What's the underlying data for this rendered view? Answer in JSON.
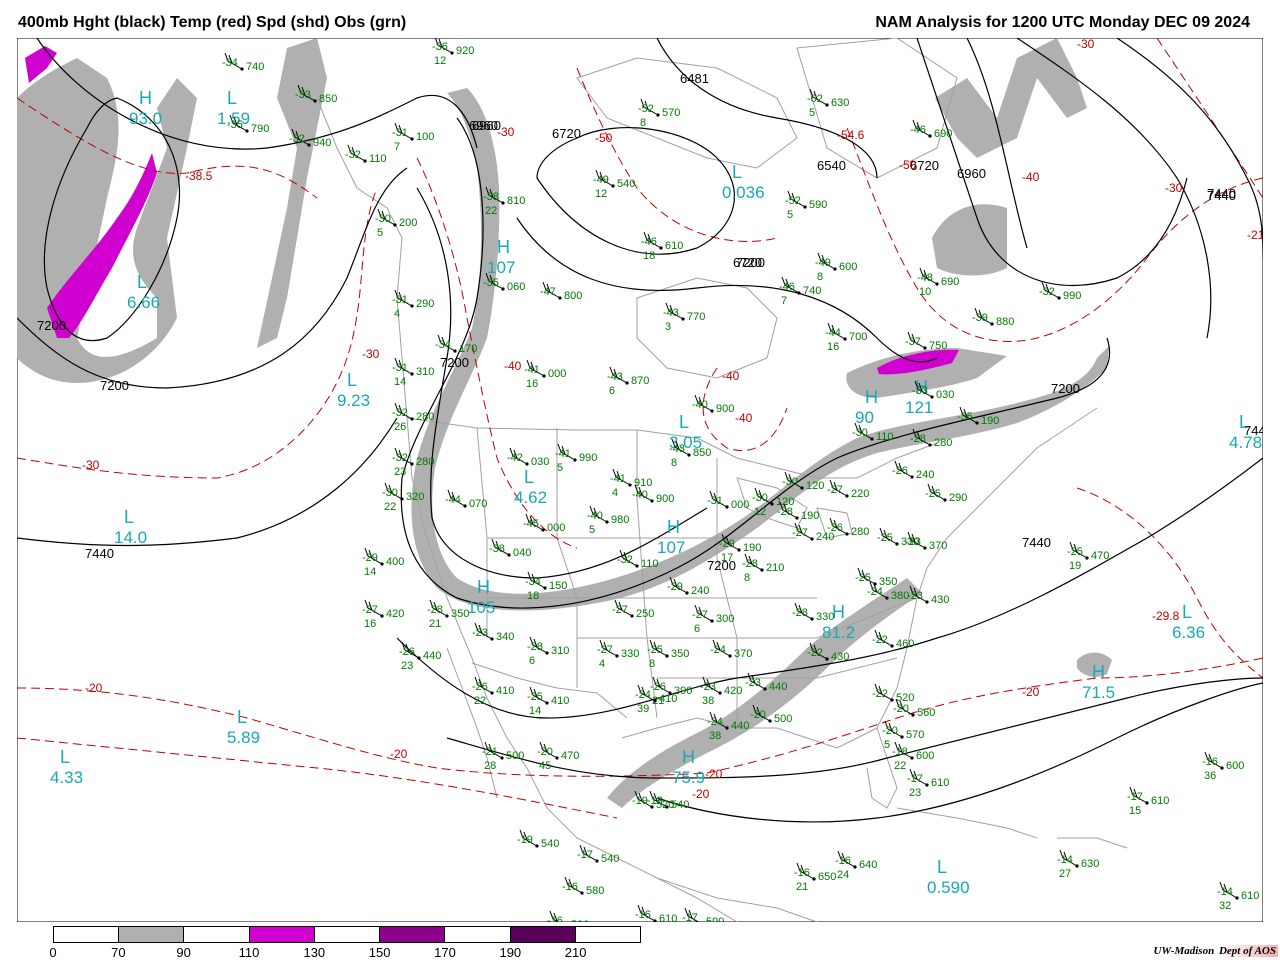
{
  "header": {
    "title_left": "400mb Hght (black) Temp (red) Spd (shd) Obs (grn)",
    "title_right": "NAM Analysis for 1200 UTC Monday  DEC 09 2024"
  },
  "colors": {
    "height_contour": "#000000",
    "temp_contour": "#c00000",
    "obs": "#007a00",
    "centers": "#18a8b8",
    "coast": "#a0a0a0",
    "speed_70_90": "#b0b0b0",
    "speed_110_130": "#d000d0",
    "speed_150_170": "#8c008c",
    "speed_190_210": "#5a005a"
  },
  "colorbar": {
    "labels": [
      "0",
      "70",
      "90",
      "110",
      "130",
      "150",
      "170",
      "190",
      "210"
    ],
    "fills": [
      "#ffffff",
      "#b0b0b0",
      "#ffffff",
      "#d000d0",
      "#ffffff",
      "#8c008c",
      "#ffffff",
      "#5a005a",
      "#ffffff"
    ]
  },
  "credit": {
    "org": "UW-Madison",
    "dept": "Dept of AOS"
  },
  "map": {
    "height_labels": [
      "6960",
      "6720",
      "6540",
      "6720",
      "6960",
      "7440",
      "7200",
      "7200",
      "7200",
      "7200",
      "7440",
      "7200",
      "7440",
      "7200",
      "6481",
      "6720",
      "6960",
      "7440",
      "7440"
    ],
    "temp_labels": [
      "-38.5",
      "-30",
      "-40",
      "-50",
      "-30",
      "-40",
      "-40",
      "-30",
      "-20",
      "-20",
      "-20",
      "-20",
      "-30",
      "-54.6",
      "-50",
      "-40",
      "-30",
      "-21",
      "-20",
      "-29.8"
    ],
    "centers": [
      {
        "letter": "H",
        "value": "93.0"
      },
      {
        "letter": "L",
        "value": "1.59"
      },
      {
        "letter": "L",
        "value": "6.66"
      },
      {
        "letter": "H",
        "value": "107"
      },
      {
        "letter": "L",
        "value": "9.23"
      },
      {
        "letter": "L",
        "value": "14.0"
      },
      {
        "letter": "L",
        "value": "4.62"
      },
      {
        "letter": "L",
        "value": "3.05"
      },
      {
        "letter": "H",
        "value": "107"
      },
      {
        "letter": "H",
        "value": "105"
      },
      {
        "letter": "L",
        "value": "5.89"
      },
      {
        "letter": "L",
        "value": "4.33"
      },
      {
        "letter": "L",
        "value": "0.036"
      },
      {
        "letter": "H",
        "value": "121"
      },
      {
        "letter": "H",
        "value": "90"
      },
      {
        "letter": "L",
        "value": "4.78"
      },
      {
        "letter": "H",
        "value": "81.2"
      },
      {
        "letter": "H",
        "value": "75.9"
      },
      {
        "letter": "L",
        "value": "0.590"
      },
      {
        "letter": "L",
        "value": "6.36"
      },
      {
        "letter": "H",
        "value": "71.5"
      }
    ],
    "observations": [
      {
        "t": "-34",
        "h": "740",
        "d": ""
      },
      {
        "t": "-35",
        "h": "790",
        "d": ""
      },
      {
        "t": "-33",
        "h": "850",
        "d": ""
      },
      {
        "t": "-32",
        "h": "940",
        "d": ""
      },
      {
        "t": "-36",
        "h": "920",
        "d": "12"
      },
      {
        "t": "-31",
        "h": "100",
        "d": "7"
      },
      {
        "t": "-32",
        "h": "110",
        "d": ""
      },
      {
        "t": "-30",
        "h": "200",
        "d": "5"
      },
      {
        "t": "-31",
        "h": "290",
        "d": "4"
      },
      {
        "t": "-31",
        "h": "310",
        "d": "14"
      },
      {
        "t": "-32",
        "h": "280",
        "d": "26"
      },
      {
        "t": "-32",
        "h": "280",
        "d": "23"
      },
      {
        "t": "-30",
        "h": "320",
        "d": "22"
      },
      {
        "t": "-29",
        "h": "400",
        "d": "14"
      },
      {
        "t": "-27",
        "h": "420",
        "d": "16"
      },
      {
        "t": "-26",
        "h": "440",
        "d": "23"
      },
      {
        "t": "-28",
        "h": "350",
        "d": "21"
      },
      {
        "t": "-23",
        "h": "340",
        "d": ""
      },
      {
        "t": "-26",
        "h": "410",
        "d": "22"
      },
      {
        "t": "-25",
        "h": "410",
        "d": "14"
      },
      {
        "t": "-21",
        "h": "500",
        "d": "28"
      },
      {
        "t": "-20",
        "h": "470",
        "d": "45"
      },
      {
        "t": "-34",
        "h": "170",
        "d": ""
      },
      {
        "t": "-44",
        "h": "070",
        "d": ""
      },
      {
        "t": "-35",
        "h": "060",
        "d": ""
      },
      {
        "t": "-38",
        "h": "810",
        "d": "22"
      },
      {
        "t": "-42",
        "h": "030",
        "d": ""
      },
      {
        "t": "-41",
        "h": "990",
        "d": "5"
      },
      {
        "t": "-41",
        "h": "910",
        "d": "4"
      },
      {
        "t": "-40",
        "h": "900",
        "d": ""
      },
      {
        "t": "-45",
        "h": "000",
        "d": ""
      },
      {
        "t": "-40",
        "h": "980",
        "d": "5"
      },
      {
        "t": "-38",
        "h": "040",
        "d": ""
      },
      {
        "t": "-34",
        "h": "150",
        "d": "18"
      },
      {
        "t": "-32",
        "h": "110",
        "d": ""
      },
      {
        "t": "-28",
        "h": "310",
        "d": "6"
      },
      {
        "t": "-27",
        "h": "330",
        "d": "4"
      },
      {
        "t": "-27",
        "h": "250",
        "d": ""
      },
      {
        "t": "-25",
        "h": "350",
        "d": "8"
      },
      {
        "t": "-29",
        "h": "240",
        "d": ""
      },
      {
        "t": "-27",
        "h": "300",
        "d": "6"
      },
      {
        "t": "-24",
        "h": "370",
        "d": ""
      },
      {
        "t": "-31",
        "h": "000",
        "d": ""
      },
      {
        "t": "-30",
        "h": "120",
        "d": "12"
      },
      {
        "t": "-29",
        "h": "190",
        "d": "17"
      },
      {
        "t": "-28",
        "h": "210",
        "d": "8"
      },
      {
        "t": "-30",
        "h": "120",
        "d": ""
      },
      {
        "t": "-28",
        "h": "190",
        "d": ""
      },
      {
        "t": "-27",
        "h": "240",
        "d": ""
      },
      {
        "t": "-28",
        "h": "330",
        "d": ""
      },
      {
        "t": "-26",
        "h": "390",
        "d": "21"
      },
      {
        "t": "-23",
        "h": "420",
        "d": "38"
      },
      {
        "t": "-24",
        "h": "410",
        "d": "39"
      },
      {
        "t": "-23",
        "h": "440",
        "d": ""
      },
      {
        "t": "-22",
        "h": "430",
        "d": ""
      },
      {
        "t": "-24",
        "h": "440",
        "d": "38"
      },
      {
        "t": "-20",
        "h": "500",
        "d": ""
      },
      {
        "t": "-19",
        "h": "520",
        "d": ""
      },
      {
        "t": "-18",
        "h": "540",
        "d": ""
      },
      {
        "t": "-19",
        "h": "540",
        "d": ""
      },
      {
        "t": "-17",
        "h": "540",
        "d": ""
      },
      {
        "t": "-16",
        "h": "580",
        "d": ""
      },
      {
        "t": "-16",
        "h": "590",
        "d": ""
      },
      {
        "t": "-16",
        "h": "610",
        "d": ""
      },
      {
        "t": "-17",
        "h": "590",
        "d": ""
      },
      {
        "t": "-16",
        "h": "650",
        "d": "21"
      },
      {
        "t": "-16",
        "h": "640",
        "d": "24"
      },
      {
        "t": "-47",
        "h": "800",
        "d": ""
      },
      {
        "t": "-43",
        "h": "770",
        "d": "3"
      },
      {
        "t": "-43",
        "h": "870",
        "d": "6"
      },
      {
        "t": "-40",
        "h": "900",
        "d": ""
      },
      {
        "t": "-43",
        "h": "850",
        "d": "8"
      },
      {
        "t": "-41",
        "h": "000",
        "d": "16"
      },
      {
        "t": "-52",
        "h": "570",
        "d": "8"
      },
      {
        "t": "-49",
        "h": "540",
        "d": "12"
      },
      {
        "t": "-46",
        "h": "610",
        "d": "18"
      },
      {
        "t": "-52",
        "h": "590",
        "d": "5"
      },
      {
        "t": "-49",
        "h": "600",
        "d": "8"
      },
      {
        "t": "-46",
        "h": "740",
        "d": "7"
      },
      {
        "t": "-62",
        "h": "630",
        "d": "5"
      },
      {
        "t": "-46",
        "h": "690",
        "d": ""
      },
      {
        "t": "-48",
        "h": "690",
        "d": "10"
      },
      {
        "t": "-44",
        "h": "700",
        "d": "16"
      },
      {
        "t": "-37",
        "h": "750",
        "d": ""
      },
      {
        "t": "-39",
        "h": "880",
        "d": ""
      },
      {
        "t": "-32",
        "h": "990",
        "d": ""
      },
      {
        "t": "-33",
        "h": "030",
        "d": ""
      },
      {
        "t": "-35",
        "h": "190",
        "d": ""
      },
      {
        "t": "-30",
        "h": "110",
        "d": ""
      },
      {
        "t": "-28",
        "h": "280",
        "d": ""
      },
      {
        "t": "-26",
        "h": "240",
        "d": ""
      },
      {
        "t": "-27",
        "h": "220",
        "d": ""
      },
      {
        "t": "-25",
        "h": "290",
        "d": ""
      },
      {
        "t": "-26",
        "h": "280",
        "d": ""
      },
      {
        "t": "-25",
        "h": "330",
        "d": ""
      },
      {
        "t": "-23",
        "h": "370",
        "d": ""
      },
      {
        "t": "-25",
        "h": "350",
        "d": ""
      },
      {
        "t": "-24",
        "h": "380",
        "d": ""
      },
      {
        "t": "-23",
        "h": "430",
        "d": ""
      },
      {
        "t": "-22",
        "h": "460",
        "d": ""
      },
      {
        "t": "-22",
        "h": "520",
        "d": ""
      },
      {
        "t": "-20",
        "h": "560",
        "d": ""
      },
      {
        "t": "-20",
        "h": "570",
        "d": "5"
      },
      {
        "t": "-18",
        "h": "600",
        "d": "22"
      },
      {
        "t": "-17",
        "h": "610",
        "d": "23"
      },
      {
        "t": "-25",
        "h": "470",
        "d": "19"
      },
      {
        "t": "-16",
        "h": "600",
        "d": "36"
      },
      {
        "t": "-17",
        "h": "610",
        "d": "15"
      },
      {
        "t": "-14",
        "h": "630",
        "d": "27"
      },
      {
        "t": "-14",
        "h": "610",
        "d": "32"
      }
    ]
  }
}
